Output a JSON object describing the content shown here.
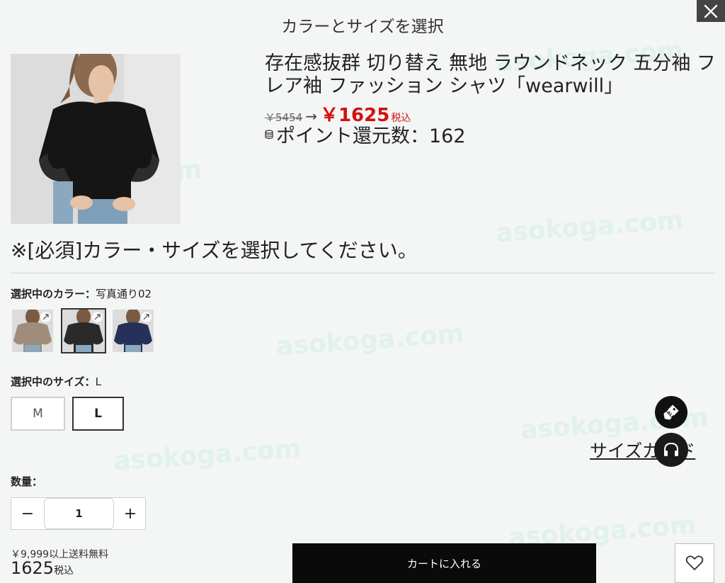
{
  "header": {
    "title": "カラーとサイズを選択",
    "close_icon": "close-icon"
  },
  "product": {
    "title": "存在感抜群 切り替え 無地 ラウンドネック 五分袖 フレア袖 ファッション シャツ「wearwill」",
    "old_price": "￥5454",
    "arrow": "→",
    "price": "￥1625",
    "tax_label": "税込",
    "points_text": "ポイント還元数：162"
  },
  "notice": "※[必須]カラー・サイズを選択してください。",
  "color": {
    "label": "選択中のカラー：",
    "selected_value": "写真通り02",
    "swatches": [
      {
        "name": "beige",
        "hex": "#a08c7a"
      },
      {
        "name": "black",
        "hex": "#2a2a2a"
      },
      {
        "name": "navy",
        "hex": "#27305a"
      }
    ]
  },
  "size": {
    "label": "選択中のサイズ：",
    "selected_value": "L",
    "options": [
      "M",
      "L"
    ]
  },
  "size_guide": "サイズガイド",
  "quantity": {
    "label": "数量：",
    "value": "1",
    "minus": "−",
    "plus": "+"
  },
  "footer": {
    "shipping_note": "￥9,999以上送料無料",
    "total": "1625",
    "total_tax": "税込",
    "cart_label": "カートに入れる"
  },
  "watermark": "asokoga.com",
  "colors": {
    "accent_red": "#d40f0f",
    "button_dark": "#0a0a0a",
    "background": "#f4f5f5"
  }
}
